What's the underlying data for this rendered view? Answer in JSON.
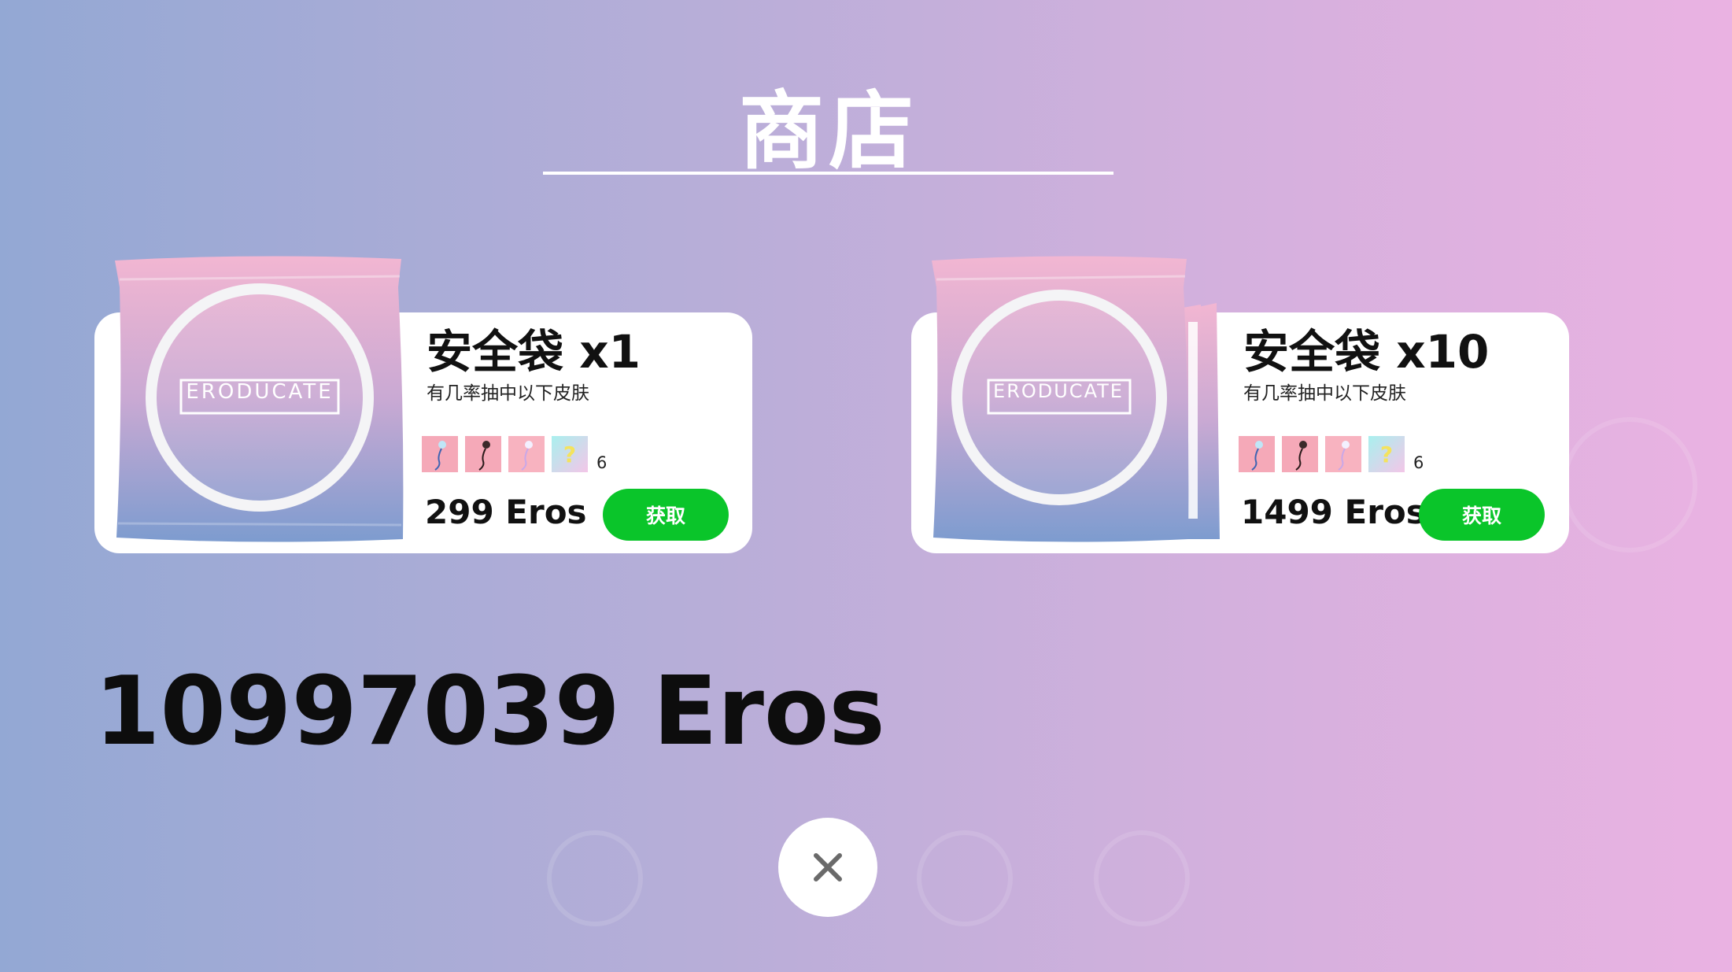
{
  "shop": {
    "title": "商店"
  },
  "products": [
    {
      "title": "安全袋 x1",
      "subtitle": "有几率抽中以下皮肤",
      "brand": "ERODUCATE",
      "skin_icons": [
        "sperm-skin-blue-icon",
        "sperm-skin-dark-icon",
        "sperm-skin-light-icon",
        "mystery-skin-icon"
      ],
      "skin_count": "6",
      "price": "299 Eros",
      "button_label": "获取"
    },
    {
      "title": "安全袋 x10",
      "subtitle": "有几率抽中以下皮肤",
      "brand": "ERODUCATE",
      "skin_icons": [
        "sperm-skin-blue-icon",
        "sperm-skin-dark-icon",
        "sperm-skin-light-icon",
        "mystery-skin-icon"
      ],
      "skin_count": "6",
      "price": "1499 Eros",
      "button_label": "获取"
    }
  ],
  "balance": {
    "text": "10997039 Eros"
  },
  "close_icon": "close-icon",
  "colors": {
    "background_left": "#93a8d4",
    "background_right": "#eab2e2",
    "button_green": "#0ac52a",
    "pack_pink": "#efb3d2",
    "pack_blue": "#7f9fd0"
  }
}
